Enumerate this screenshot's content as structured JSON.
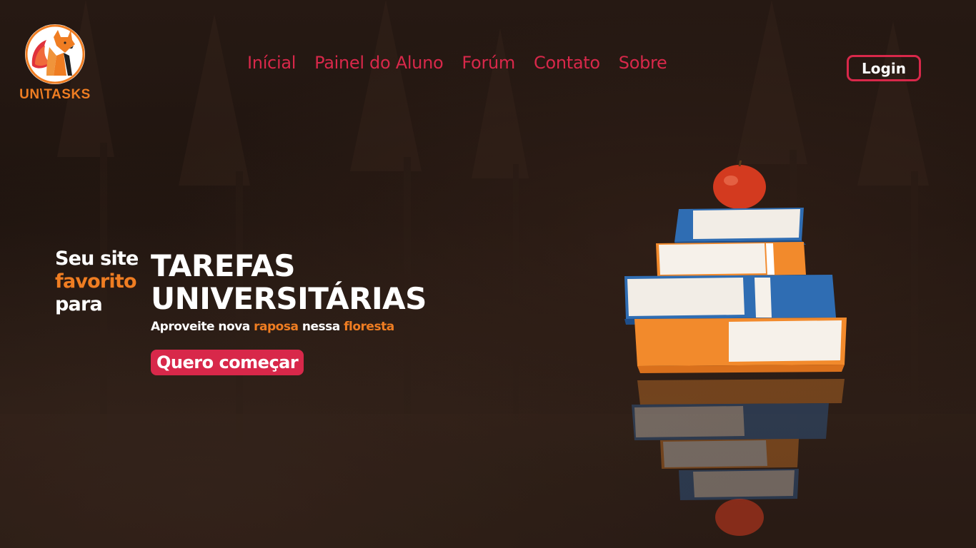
{
  "brand": {
    "name": "UN\\TASKS"
  },
  "nav": {
    "items": [
      {
        "label": "Inícial"
      },
      {
        "label": "Painel do Aluno"
      },
      {
        "label": "Forúm"
      },
      {
        "label": "Contato"
      },
      {
        "label": "Sobre"
      }
    ],
    "login_label": "Login"
  },
  "hero": {
    "lead_1": "Seu site",
    "lead_2": "favorito",
    "lead_3": "para",
    "title_1": "TAREFAS",
    "title_2": "UNIVERSITÁRIAS",
    "sub_1": "Aproveite nova ",
    "sub_2": "raposa",
    "sub_3": " nessa ",
    "sub_4": "floresta",
    "cta_label": "Quero começar"
  },
  "colors": {
    "accent": "#d8284a",
    "orange": "#ef7d22",
    "background": "#1e130e"
  },
  "icons": {
    "logo": "fox-logo-icon",
    "illustration": "books-with-apple-illustration"
  }
}
